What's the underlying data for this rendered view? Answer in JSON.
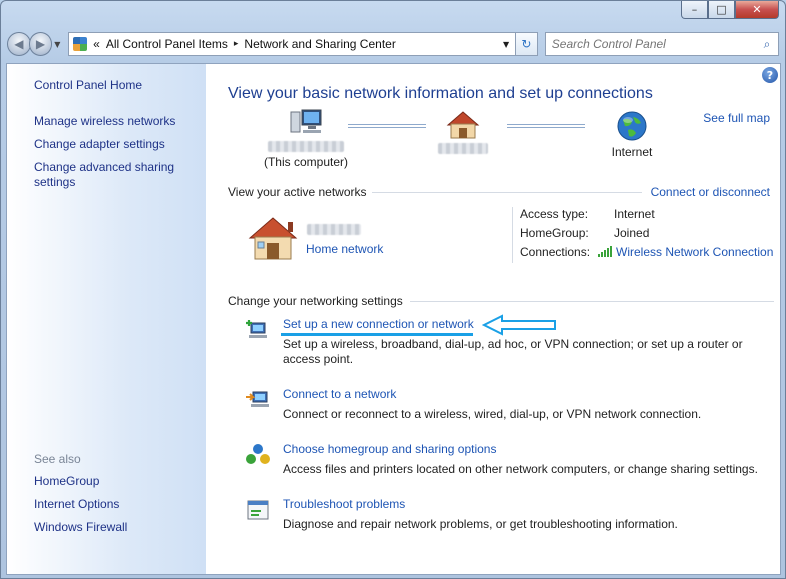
{
  "window": {
    "caption_buttons": {
      "minimize": "–",
      "maximize": "□",
      "close": "✕"
    }
  },
  "addressbar": {
    "back_icon": "◀",
    "forward_icon": "▶",
    "overflow": "«",
    "crumbs": [
      "All Control Panel Items",
      "Network and Sharing Center"
    ],
    "separator": "▸",
    "dropdown": "▼",
    "refresh": "↻"
  },
  "search": {
    "placeholder": "Search Control Panel",
    "icon": "⌕"
  },
  "sidebar": {
    "home": "Control Panel Home",
    "links": [
      "Manage wireless networks",
      "Change adapter settings",
      "Change advanced sharing settings"
    ],
    "see_also_title": "See also",
    "see_also": [
      "HomeGroup",
      "Internet Options",
      "Windows Firewall"
    ]
  },
  "main": {
    "help": "?",
    "title": "View your basic network information and set up connections",
    "see_full_map": "See full map",
    "map": {
      "computer_sub": "(This computer)",
      "internet": "Internet"
    },
    "active_networks": {
      "heading": "View your active networks",
      "connect_link": "Connect or disconnect",
      "network_type": "Home network",
      "access_type_label": "Access type:",
      "access_type_value": "Internet",
      "homegroup_label": "HomeGroup:",
      "homegroup_value": "Joined",
      "connections_label": "Connections:",
      "connections_value": "Wireless Network Connection"
    },
    "settings": {
      "heading": "Change your networking settings",
      "tasks": [
        {
          "link": "Set up a new connection or network",
          "desc": "Set up a wireless, broadband, dial-up, ad hoc, or VPN connection; or set up a router or access point."
        },
        {
          "link": "Connect to a network",
          "desc": "Connect or reconnect to a wireless, wired, dial-up, or VPN network connection."
        },
        {
          "link": "Choose homegroup and sharing options",
          "desc": "Access files and printers located on other network computers, or change sharing settings."
        },
        {
          "link": "Troubleshoot problems",
          "desc": "Diagnose and repair network problems, or get troubleshooting information."
        }
      ]
    }
  },
  "colors": {
    "link": "#1e55b4",
    "title": "#1e3f91",
    "highlight_arrow": "#1aa0e6"
  }
}
